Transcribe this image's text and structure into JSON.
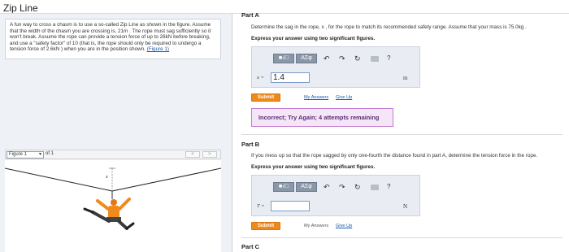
{
  "page": {
    "title": "Zip Line"
  },
  "problem": {
    "text": "A fun way to cross a chasm is to use a so-called Zip Line as shown in the figure. Assume that the width of the chasm you are crossing is, 21m . The rope must sag sufficiently so it won't break. Assume the rope can provide a tension force of up to 26kN before breaking, and use a \"safety factor\" of 10 (that is, the rope should only be required to undergo a tension force of 2.6kN ) when you are in the position shown.",
    "link_text": "(Figure 1)"
  },
  "figure": {
    "selected": "Figure 1",
    "of_label": "of 1",
    "prev_label": "<",
    "next_label": ">",
    "sag_label": "x"
  },
  "toolbar": {
    "templates_label": "■√□",
    "symbols_label": "ΑΣφ",
    "undo_glyph": "↶",
    "redo_glyph": "↷",
    "reset_glyph": "↻",
    "help_glyph": "?"
  },
  "part_a": {
    "label": "Part A",
    "question": "Determine the sag in the rope, x , for the rope to match its recommended safety range.  Assume that your mass is 75.0kg .",
    "instruction": "Express your answer using two significant figures.",
    "var_label": "x =",
    "answer_value": "1.4",
    "unit": "m",
    "submit_label": "Submit",
    "my_answers_label": "My Answers",
    "give_up_label": "Give Up",
    "feedback": "Incorrect; Try Again; 4 attempts remaining"
  },
  "part_b": {
    "label": "Part B",
    "question": "If you mess up so that the rope sagged by only one-fourth the distance found in part A, determine the tension force in the rope.",
    "instruction": "Express your answer using two significant figures.",
    "var_label": "T =",
    "answer_value": "",
    "unit": "N",
    "submit_label": "Submit",
    "my_answers_label": "My Answers",
    "give_up_label": "Give Up"
  },
  "part_c": {
    "label": "Part C"
  },
  "colors": {
    "accent_orange": "#ee8a1c",
    "link_blue": "#1a5aa8",
    "feedback_bg": "#f4e6f7",
    "feedback_border": "#c27bd0",
    "feedback_text": "#5a2a78"
  }
}
